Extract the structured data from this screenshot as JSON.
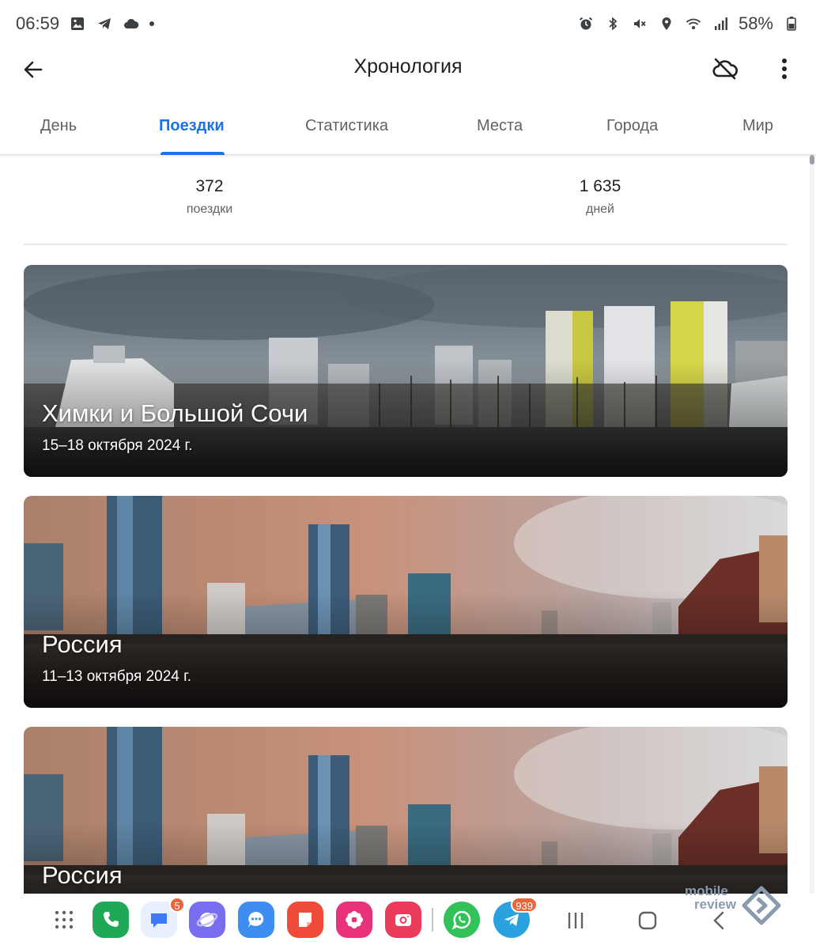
{
  "status_bar": {
    "time": "06:59",
    "battery": "58%",
    "colors": {
      "text": "#3c4043"
    }
  },
  "app_bar": {
    "title": "Хронология"
  },
  "tabs": [
    {
      "label": "День",
      "active": false
    },
    {
      "label": "Поездки",
      "active": true
    },
    {
      "label": "Статистика",
      "active": false
    },
    {
      "label": "Места",
      "active": false
    },
    {
      "label": "Города",
      "active": false
    },
    {
      "label": "Мир",
      "active": false
    }
  ],
  "stats": [
    {
      "value": "372",
      "label": "поездки"
    },
    {
      "value": "1 635",
      "label": "дней"
    }
  ],
  "trips": [
    {
      "title": "Химки и Большой Сочи",
      "dates": "15–18 октября 2024 г."
    },
    {
      "title": "Россия",
      "dates": "11–13 октября 2024 г."
    },
    {
      "title": "Россия"
    }
  ],
  "dock": {
    "apps": [
      {
        "icon": "apps-grid-icon"
      },
      {
        "icon": "phone-icon",
        "color": "#1fa855"
      },
      {
        "icon": "messages-icon",
        "color": "#3d7bf5",
        "badge": "5"
      },
      {
        "icon": "samsung-internet-icon",
        "color": "#7a6ef0"
      },
      {
        "icon": "chat-icon",
        "color": "#3e8df0"
      },
      {
        "icon": "notes-icon",
        "color": "#f04a3a"
      },
      {
        "icon": "gallery-icon",
        "color": "#e8337a"
      },
      {
        "icon": "camera-icon",
        "color": "#ea3b5a"
      },
      {
        "icon": "whatsapp-icon",
        "color": "#33c25a"
      },
      {
        "icon": "telegram-icon",
        "color": "#2aa2e0",
        "badge": "939"
      }
    ],
    "watermark": [
      "mobile",
      "review"
    ]
  },
  "colors": {
    "accent": "#1a73e8",
    "tab_inactive": "#5f6368"
  }
}
